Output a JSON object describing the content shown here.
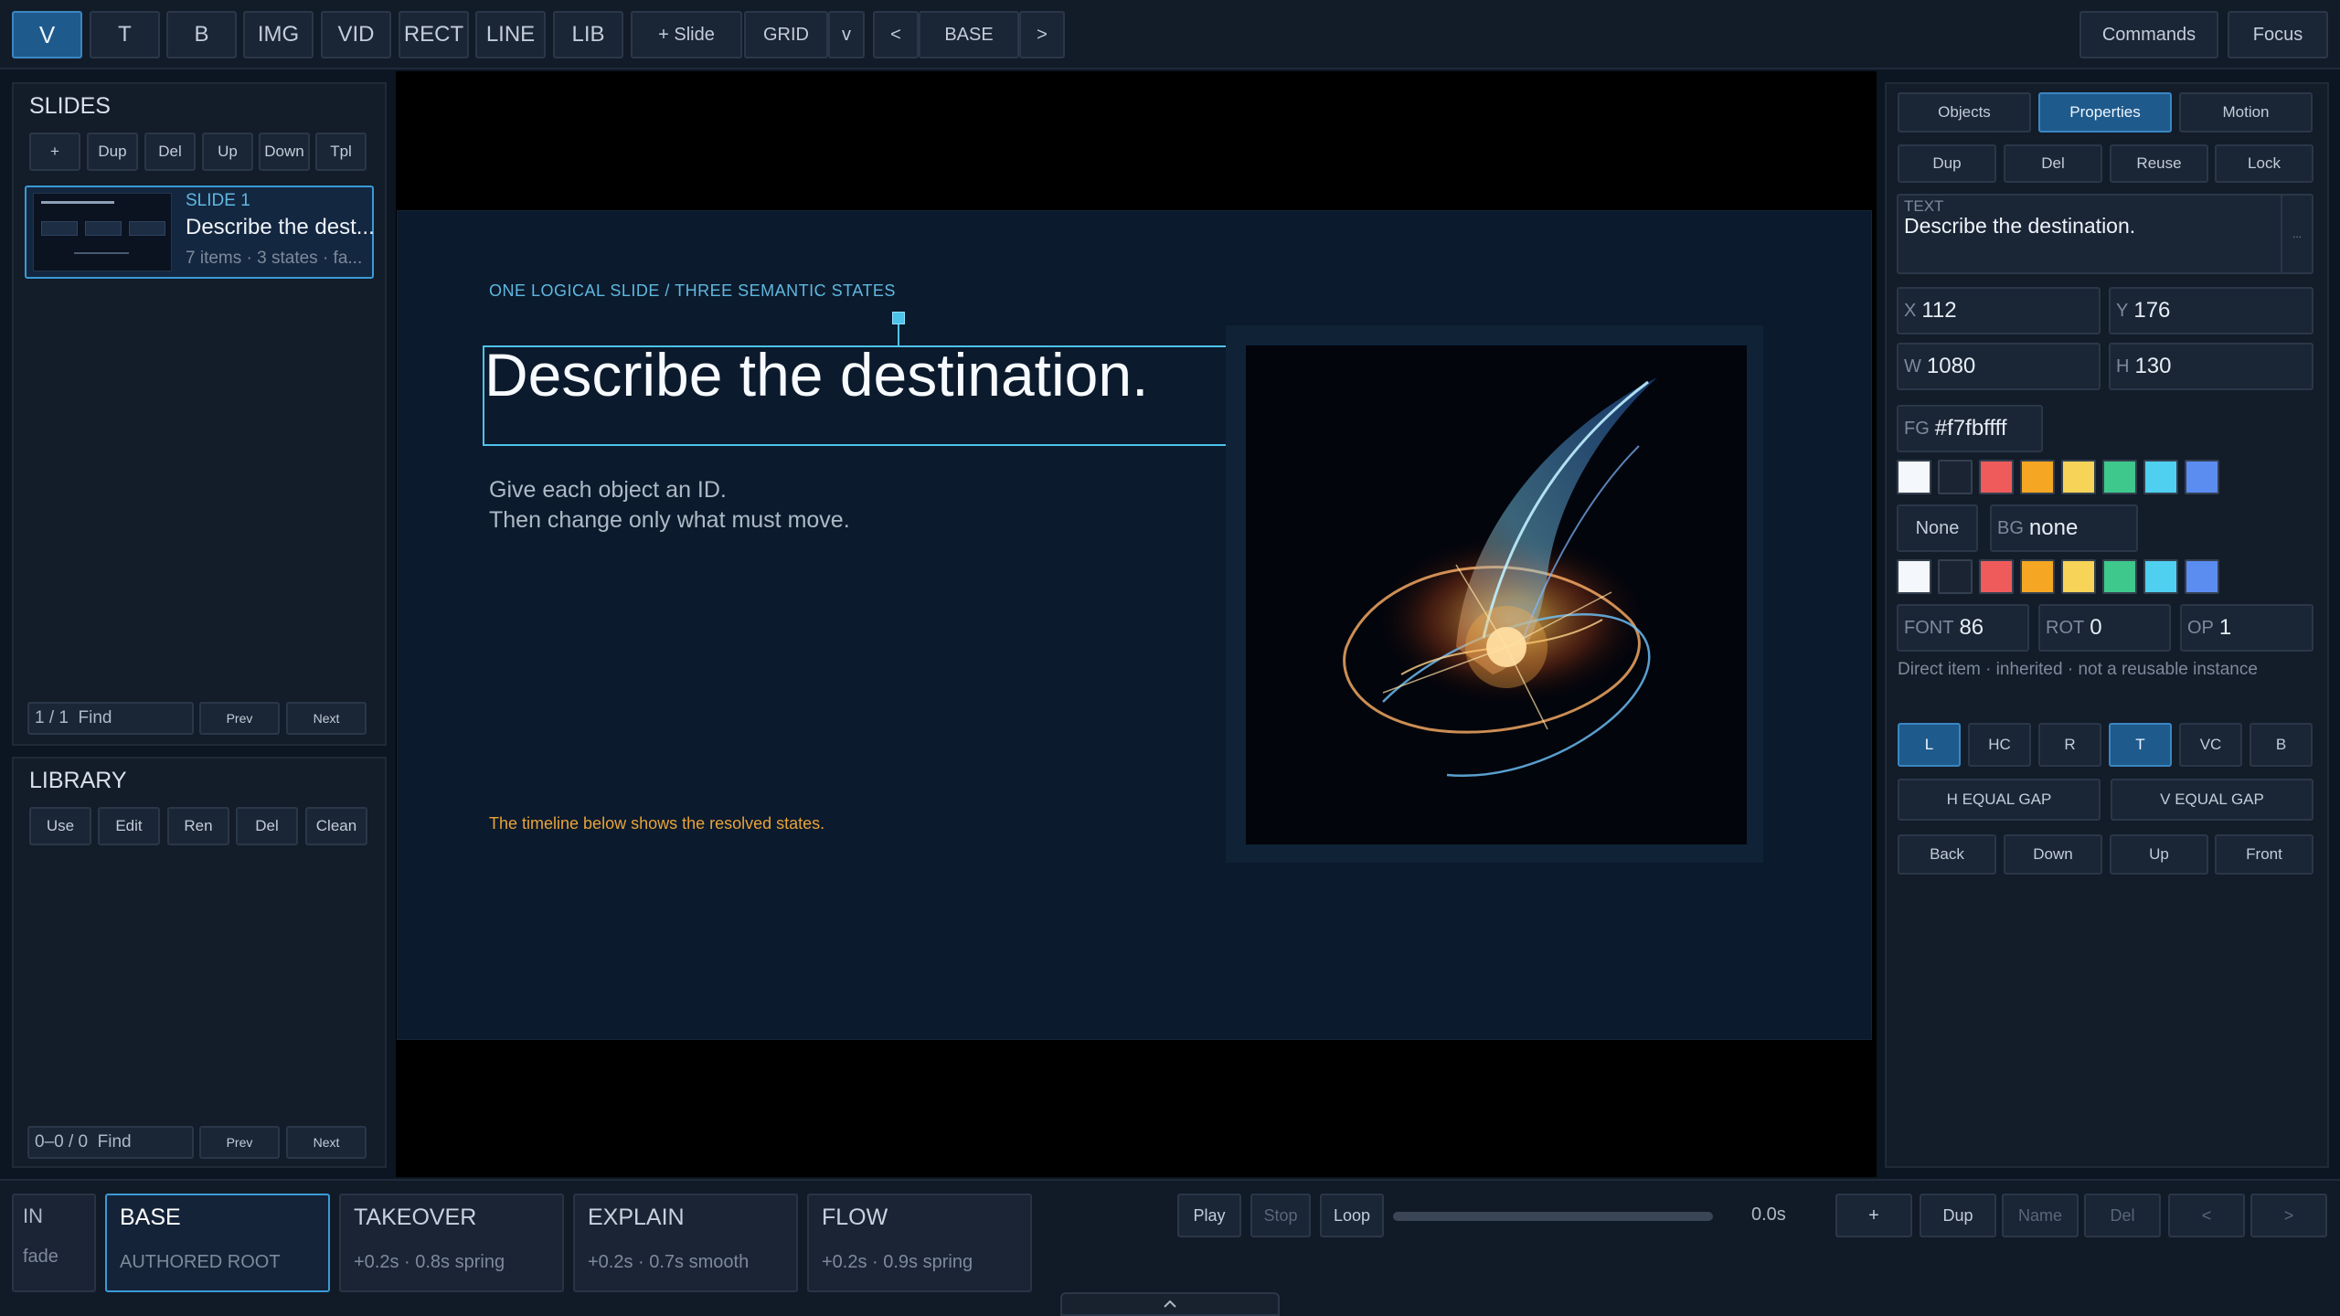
{
  "toolbar": {
    "tools": [
      "V",
      "T",
      "B",
      "IMG",
      "VID",
      "RECT",
      "LINE",
      "LIB"
    ],
    "add_slide": "+ Slide",
    "grid": "GRID",
    "grid_menu": "v",
    "prev_state": "<",
    "state": "BASE",
    "next_state": ">",
    "commands": "Commands",
    "focus": "Focus"
  },
  "slides_panel": {
    "title": "SLIDES",
    "actions": [
      "+",
      "Dup",
      "Del",
      "Up",
      "Down",
      "Tpl"
    ],
    "slide": {
      "number": "SLIDE 1",
      "title": "Describe the dest...",
      "meta": "7 items · 3 states · fa..."
    },
    "find_value": "1 / 1  Find",
    "prev": "Prev",
    "next": "Next"
  },
  "library_panel": {
    "title": "LIBRARY",
    "actions": [
      "Use",
      "Edit",
      "Ren",
      "Del",
      "Clean"
    ],
    "find_value": "0–0 / 0  Find",
    "prev": "Prev",
    "next": "Next"
  },
  "canvas": {
    "kicker": "ONE LOGICAL SLIDE / THREE SEMANTIC STATES",
    "title": "Describe the destination.",
    "body_line1": "Give each object an ID.",
    "body_line2": "Then change only what must move.",
    "footnote": "The timeline below shows the resolved states.",
    "image_icon": "abstract-light-swirl-image"
  },
  "inspector": {
    "tabs": [
      "Objects",
      "Properties",
      "Motion"
    ],
    "active_tab": "Properties",
    "actions": [
      "Dup",
      "Del",
      "Reuse",
      "Lock"
    ],
    "text_label": "TEXT",
    "text_value": "Describe the destination.",
    "text_expand": "...",
    "x_label": "X",
    "x_value": "112",
    "y_label": "Y",
    "y_value": "176",
    "w_label": "W",
    "w_value": "1080",
    "h_label": "H",
    "h_value": "130",
    "fg_label": "FG",
    "fg_value": "#f7fbffff",
    "none_button": "None",
    "bg_label": "BG",
    "bg_value": "none",
    "swatch_colors": [
      "#f4f7fb",
      "#1b2432",
      "#ef5b5b",
      "#f5a623",
      "#f7d358",
      "#3ec88c",
      "#4fd0f0",
      "#5b8cf0"
    ],
    "font_label": "FONT",
    "font_value": "86",
    "rot_label": "ROT",
    "rot_value": "0",
    "op_label": "OP",
    "op_value": "1",
    "status": "Direct item · inherited · not a reusable instance",
    "align_buttons": [
      "L",
      "HC",
      "R",
      "T",
      "VC",
      "B"
    ],
    "h_equal_gap": "H EQUAL GAP",
    "v_equal_gap": "V EQUAL GAP",
    "order_buttons": [
      "Back",
      "Down",
      "Up",
      "Front"
    ]
  },
  "timeline": {
    "in_label": "IN",
    "in_value": "fade",
    "states": [
      {
        "name": "BASE",
        "detail": "AUTHORED ROOT"
      },
      {
        "name": "TAKEOVER",
        "detail": "+0.2s · 0.8s spring"
      },
      {
        "name": "EXPLAIN",
        "detail": "+0.2s · 0.7s smooth"
      },
      {
        "name": "FLOW",
        "detail": "+0.2s · 0.9s spring"
      }
    ],
    "play": "Play",
    "stop": "Stop",
    "loop": "Loop",
    "progress": 0,
    "time": "0.0s",
    "add": "+",
    "dup": "Dup",
    "name": "Name",
    "del": "Del",
    "prev": "<",
    "next": ">"
  },
  "colors": {
    "accent": "#3a9ad6",
    "selection": "#4ec3ea",
    "footnote": "#e8a33a",
    "kicker": "#5fb8e0"
  }
}
